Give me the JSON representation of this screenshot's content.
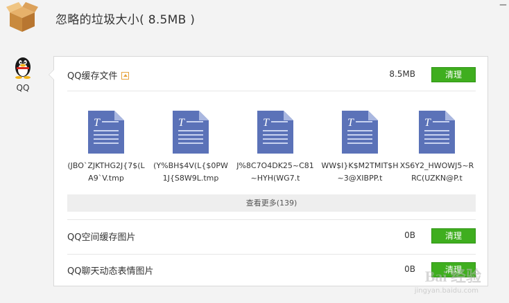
{
  "header": {
    "title": "忽略的垃圾大小( 8.5MB )"
  },
  "app": {
    "name": "QQ",
    "icon": "qq-penguin-icon"
  },
  "sections": [
    {
      "label": "QQ缓存文件",
      "size": "8.5MB",
      "button": "清理",
      "expanded": true
    },
    {
      "label": "QQ空间缓存图片",
      "size": "0B",
      "button": "清理"
    },
    {
      "label": "QQ聊天动态表情图片",
      "size": "0B",
      "button": "清理"
    }
  ],
  "files": [
    {
      "name": "(JBO`ZJKTHG2J{7$(LA9`V.tmp",
      "icon": "text-document-icon"
    },
    {
      "name": "(Y%BH$4V(L{$0PW1J{S8W9L.tmp",
      "icon": "text-document-icon"
    },
    {
      "name": "J%8C7O4DK25~C81~HYH(WG7.t",
      "icon": "text-document-icon"
    },
    {
      "name": "WW$I}K$M2TMIT$H~3@XIBPP.t",
      "icon": "text-document-icon"
    },
    {
      "name": "XS6Y2_HWOWJ5~RRC(UZKN@P.t",
      "icon": "text-document-icon"
    }
  ],
  "more": {
    "label": "查看更多(139)"
  },
  "watermark": {
    "text": "Bai 经验",
    "sub": "jingyan.baidu.com"
  },
  "colors": {
    "button_green": "#3fae1f",
    "doc_blue": "#5b72b8",
    "toggle_orange": "#e6a23c"
  }
}
